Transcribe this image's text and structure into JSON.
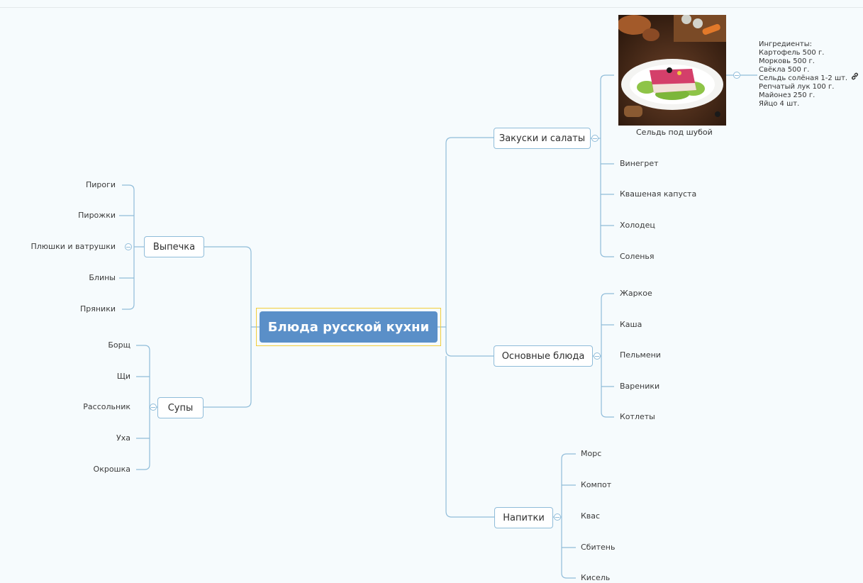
{
  "central": "Блюда русской кухни",
  "left_branches": {
    "baking": {
      "label": "Выпечка",
      "items": [
        "Пироги",
        "Пирожки",
        "Плюшки и ватрушки",
        "Блины",
        "Пряники"
      ]
    },
    "soups": {
      "label": "Супы",
      "items": [
        "Борщ",
        "Щи",
        "Рассольник",
        "Уха",
        "Окрошка"
      ]
    }
  },
  "right_branches": {
    "appetizers": {
      "label": "Закуски и салаты",
      "image_caption": "Сельдь под шубой",
      "items": [
        "Винегрет",
        "Квашеная капуста",
        "Холодец",
        "Соленья"
      ]
    },
    "mains": {
      "label": "Основные блюда",
      "items": [
        "Жаркое",
        "Каша",
        "Пельмени",
        "Вареники",
        "Котлеты"
      ]
    },
    "drinks": {
      "label": "Напитки",
      "items": [
        "Морс",
        "Компот",
        "Квас",
        "Сбитень",
        "Кисель"
      ]
    }
  },
  "note": {
    "lines": [
      "Ингредиенты:",
      "Картофель 500 г.",
      "Морковь 500 г.",
      "Свёкла 500 г.",
      "Сельдь солёная 1-2 шт.",
      "Репчатый лук 100 г.",
      "Майонез 250 г.",
      "Яйцо 4 шт."
    ]
  },
  "colors": {
    "wire": "#8fbcd9",
    "central_fill": "#5a8fc8",
    "selection": "#f2cd3a",
    "background": "#f6fbfd"
  },
  "icons": {
    "link": "link-icon",
    "collapse": "collapse-toggle-icon"
  }
}
